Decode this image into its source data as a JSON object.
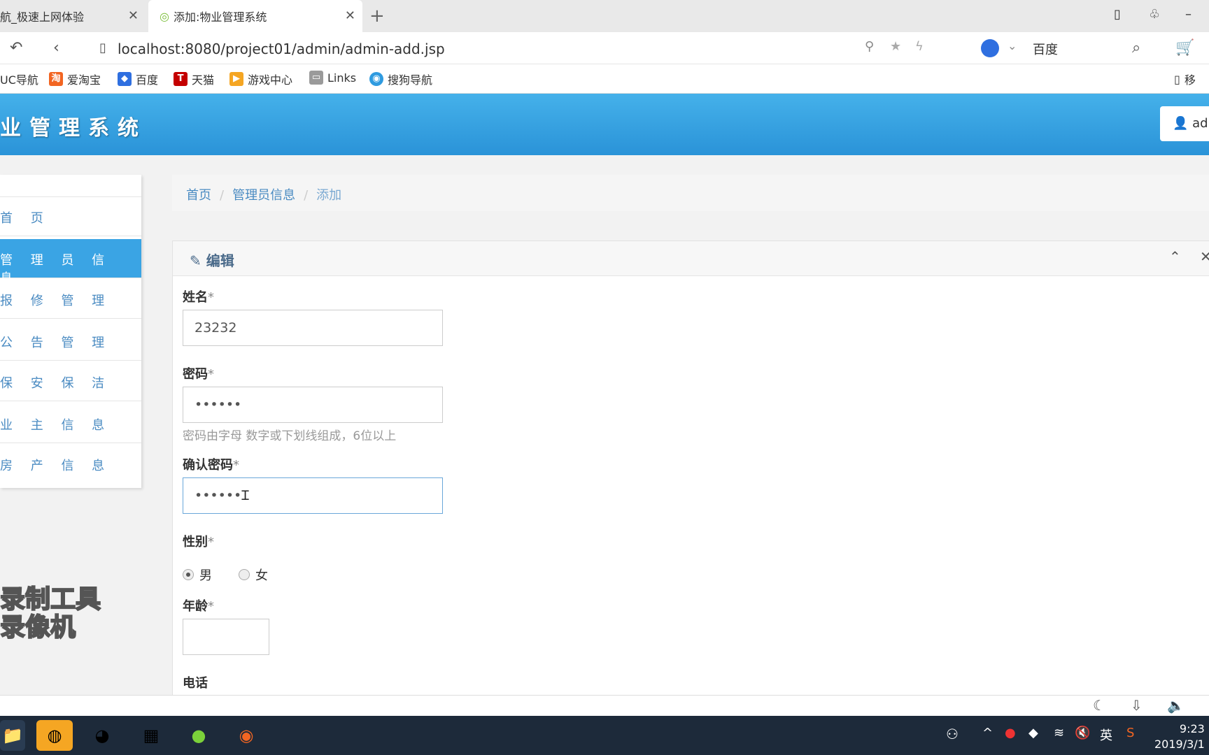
{
  "browser": {
    "tabs": [
      {
        "label": "航_极速上网体验"
      },
      {
        "label": "添加:物业管理系统"
      }
    ],
    "url": "localhost:8080/project01/admin/admin-add.jsp",
    "search_engine": "百度",
    "bookmarks": [
      {
        "label": "UC导航"
      },
      {
        "label": "爱淘宝"
      },
      {
        "label": "百度"
      },
      {
        "label": "天猫"
      },
      {
        "label": "游戏中心"
      },
      {
        "label": "Links"
      },
      {
        "label": "搜狗导航"
      }
    ],
    "bookmark_extra": "移"
  },
  "app": {
    "title": "业管理系统",
    "user_label": "adı"
  },
  "sidebar": {
    "items": [
      {
        "label": "首页",
        "text": "首 页"
      },
      {
        "label": "管理员信息",
        "text": "管 理 员 信 息"
      },
      {
        "label": "报修管理",
        "text": "报 修 管 理"
      },
      {
        "label": "公告管理",
        "text": "公 告 管 理"
      },
      {
        "label": "保安保洁",
        "text": "保 安 保 洁"
      },
      {
        "label": "业主信息",
        "text": "业 主 信 息"
      },
      {
        "label": "房产信息",
        "text": "房 产 信 息"
      }
    ]
  },
  "breadcrumb": [
    "首页",
    "管理员信息",
    "添加"
  ],
  "panel": {
    "title": "编辑"
  },
  "form": {
    "name_label": "姓名",
    "name_value": "23232",
    "password_label": "密码",
    "password_value": "••••••",
    "password_hint": "密码由字母 数字或下划线组成，6位以上",
    "confirm_label": "确认密码",
    "confirm_value": "••••••",
    "gender_label": "性别",
    "gender_male": "男",
    "gender_female": "女",
    "age_label": "年龄",
    "age_value": "",
    "phone_label": "电话",
    "required_mark": "*"
  },
  "watermark": [
    "录制工具",
    "录像机"
  ],
  "taskbar": {
    "time": "9:23",
    "date": "2019/3/1",
    "ime": "英"
  }
}
